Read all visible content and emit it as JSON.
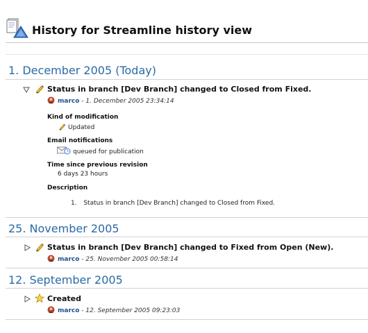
{
  "header": {
    "title": "History for Streamline history view",
    "icon": "document-history-icon"
  },
  "groups": [
    {
      "date_heading": "1. December 2005 (Today)",
      "entry": {
        "expanded": true,
        "title": "Status in branch [Dev Branch] changed to Closed from Fixed.",
        "icon": "pencil-icon",
        "author": "marco",
        "separator": "-",
        "timestamp": "1. December 2005 23:34:14",
        "details": {
          "kind_label": "Kind of modification",
          "kind_value": "Updated",
          "email_label": "Email notifications",
          "email_value": "queued for publication",
          "time_label": "Time since previous revision",
          "time_value": "6 days 23 hours",
          "description_label": "Description",
          "description_items": [
            {
              "number": "1.",
              "text": "Status in branch [Dev Branch] changed to Closed from Fixed."
            }
          ]
        }
      }
    },
    {
      "date_heading": "25. November 2005",
      "entry": {
        "expanded": false,
        "title": "Status in branch [Dev Branch] changed to Fixed from Open (New).",
        "icon": "pencil-icon",
        "author": "marco",
        "separator": "-",
        "timestamp": "25. November 2005 00:58:14"
      }
    },
    {
      "date_heading": "12. September 2005",
      "entry": {
        "expanded": false,
        "title": "Created",
        "icon": "star-icon",
        "author": "marco",
        "separator": "-",
        "timestamp": "12. September 2005 09:23:03"
      }
    }
  ],
  "colors": {
    "date_heading": "#2a6aa6",
    "author_link": "#1f4f8f"
  }
}
